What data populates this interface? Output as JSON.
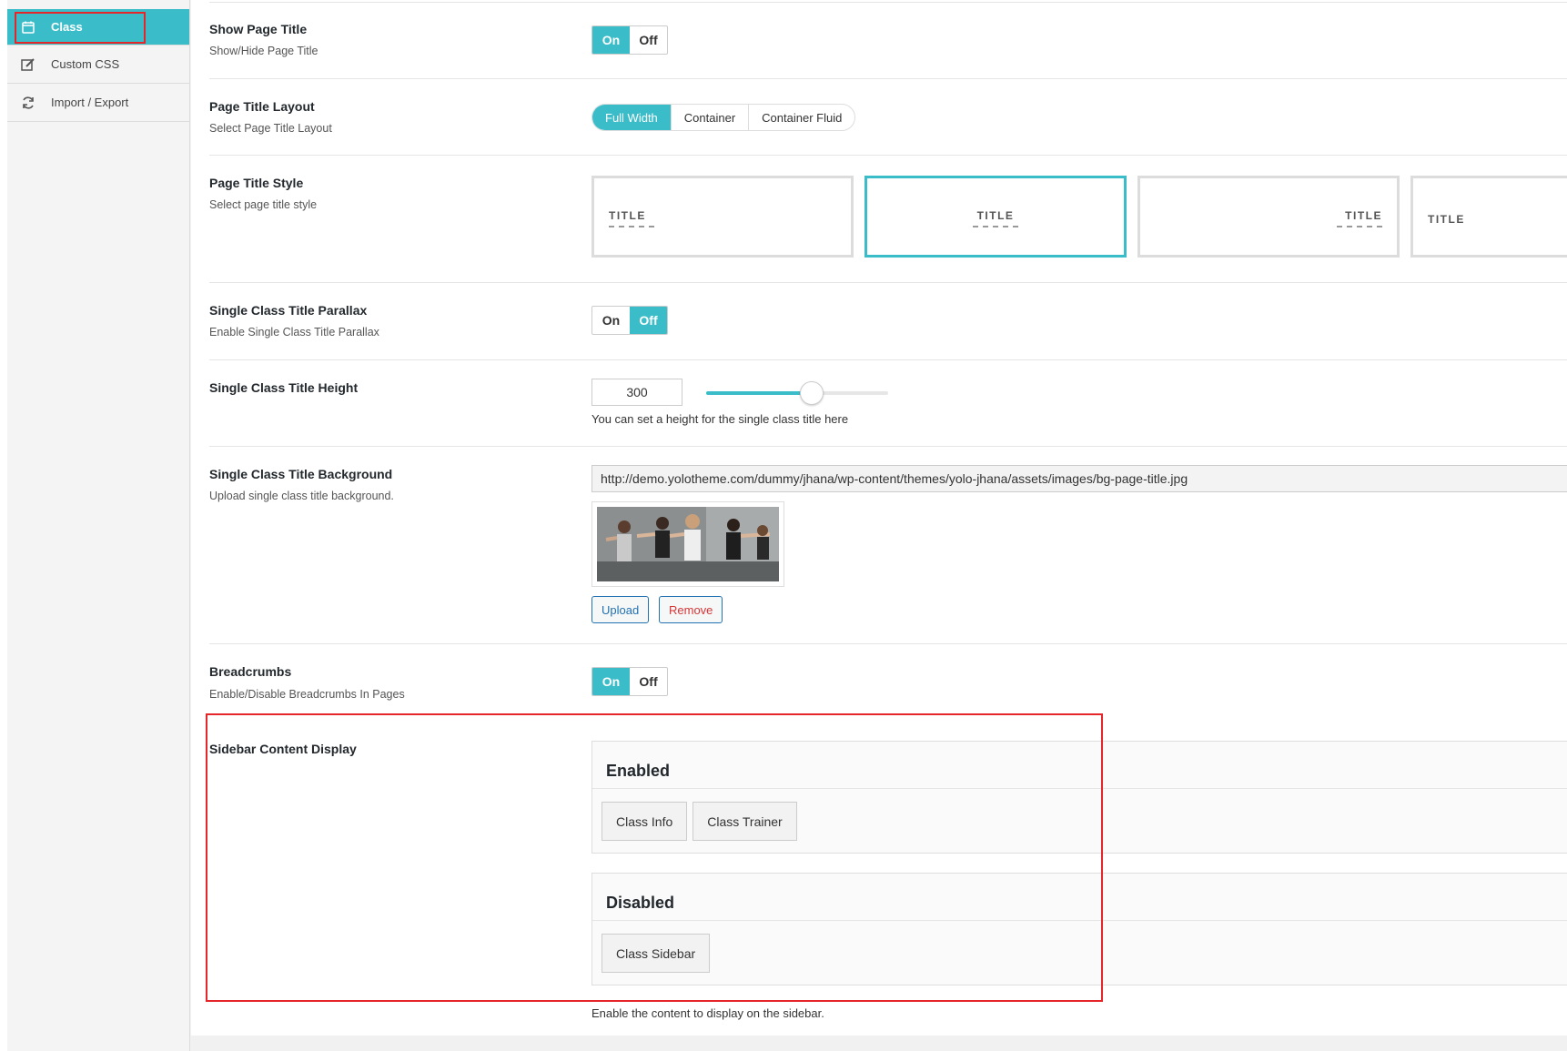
{
  "sidebar": {
    "items": [
      {
        "label": "Class",
        "icon": "calendar-icon",
        "active": true
      },
      {
        "label": "Custom CSS",
        "icon": "edit-icon",
        "active": false
      },
      {
        "label": "Import / Export",
        "icon": "refresh-icon",
        "active": false
      }
    ]
  },
  "colors": {
    "accent": "#3bbdc9",
    "highlight": "#e4262b",
    "remove": "#d63638",
    "upload": "#2271b1"
  },
  "settings": {
    "show_page_title": {
      "label": "Show Page Title",
      "desc": "Show/Hide Page Title",
      "on": "On",
      "off": "Off",
      "value": "On"
    },
    "page_title_layout": {
      "label": "Page Title Layout",
      "desc": "Select Page Title Layout",
      "options": [
        "Full Width",
        "Container",
        "Container Fluid"
      ],
      "selected": "Full Width"
    },
    "page_title_style": {
      "label": "Page Title Style",
      "desc": "Select page title style",
      "tiles": [
        "TITLE",
        "TITLE",
        "TITLE",
        "TITLE"
      ],
      "selected_index": 1
    },
    "parallax": {
      "label": "Single Class Title Parallax",
      "desc": "Enable Single Class Title Parallax",
      "on": "On",
      "off": "Off",
      "value": "Off"
    },
    "title_height": {
      "label": "Single Class Title Height",
      "value": "300",
      "help": "You can set a height for the single class title here",
      "slider_fraction": 0.58
    },
    "title_background": {
      "label": "Single Class Title Background",
      "desc": "Upload single class title background.",
      "url": "http://demo.yolotheme.com/dummy/jhana/wp-content/themes/yolo-jhana/assets/images/bg-page-title.jpg",
      "upload": "Upload",
      "remove": "Remove"
    },
    "breadcrumbs": {
      "label": "Breadcrumbs",
      "desc": "Enable/Disable Breadcrumbs In Pages",
      "on": "On",
      "off": "Off",
      "value": "On"
    },
    "sidebar_content": {
      "label": "Sidebar Content Display",
      "enabled_title": "Enabled",
      "enabled": [
        "Class Info",
        "Class Trainer"
      ],
      "disabled_title": "Disabled",
      "disabled": [
        "Class Sidebar"
      ],
      "help": "Enable the content to display on the sidebar."
    }
  }
}
